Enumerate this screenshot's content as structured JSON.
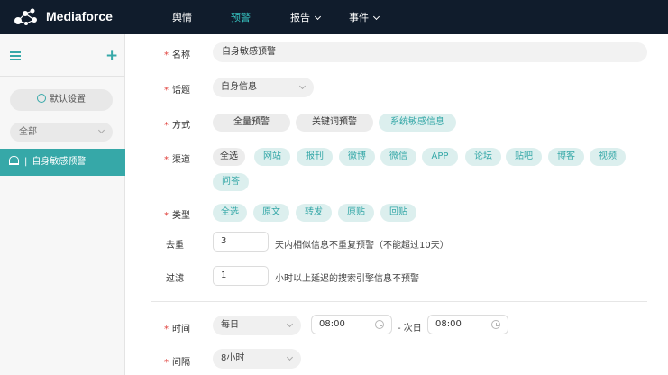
{
  "header": {
    "brand": "Mediaforce",
    "nav": [
      {
        "label": "舆情",
        "active": false,
        "dropdown": false
      },
      {
        "label": "预警",
        "active": true,
        "dropdown": false
      },
      {
        "label": "报告",
        "active": false,
        "dropdown": true
      },
      {
        "label": "事件",
        "active": false,
        "dropdown": true
      }
    ],
    "accent_color": "#36c2c0",
    "bg_color": "#101c2c"
  },
  "sidebar": {
    "settings_label": "默认设置",
    "filter_value": "全部",
    "items": [
      {
        "label": "自身敏感预警",
        "selected": true
      }
    ],
    "selected_color": "#36a8a8"
  },
  "form": {
    "name": {
      "label": "名称",
      "value": "自身敏感预警"
    },
    "topic": {
      "label": "话题",
      "value": "自身信息"
    },
    "method": {
      "label": "方式",
      "options": [
        {
          "label": "全量预警",
          "selected": false
        },
        {
          "label": "关键词预警",
          "selected": false
        },
        {
          "label": "系统敏感信息",
          "selected": true
        }
      ]
    },
    "channel": {
      "label": "渠道",
      "options": [
        {
          "label": "全选",
          "selected": false
        },
        {
          "label": "网站",
          "selected": true
        },
        {
          "label": "报刊",
          "selected": true
        },
        {
          "label": "微博",
          "selected": true
        },
        {
          "label": "微信",
          "selected": true
        },
        {
          "label": "APP",
          "selected": true
        },
        {
          "label": "论坛",
          "selected": true
        },
        {
          "label": "贴吧",
          "selected": true
        },
        {
          "label": "博客",
          "selected": true
        },
        {
          "label": "视频",
          "selected": true
        },
        {
          "label": "问答",
          "selected": true
        }
      ]
    },
    "type": {
      "label": "类型",
      "options": [
        {
          "label": "全选",
          "selected": true
        },
        {
          "label": "原文",
          "selected": true
        },
        {
          "label": "转发",
          "selected": true
        },
        {
          "label": "原贴",
          "selected": true
        },
        {
          "label": "回贴",
          "selected": true
        }
      ]
    },
    "dedupe": {
      "label": "去重",
      "value": "3",
      "note": "天内相似信息不重复预警（不能超过10天）"
    },
    "filter": {
      "label": "过滤",
      "value": "1",
      "note": "小时以上延迟的搜索引擎信息不预警"
    },
    "time": {
      "label": "时间",
      "frequency": "每日",
      "start": "08:00",
      "separator": "- 次日",
      "end": "08:00"
    },
    "interval": {
      "label": "间隔",
      "value": "8小时"
    }
  }
}
